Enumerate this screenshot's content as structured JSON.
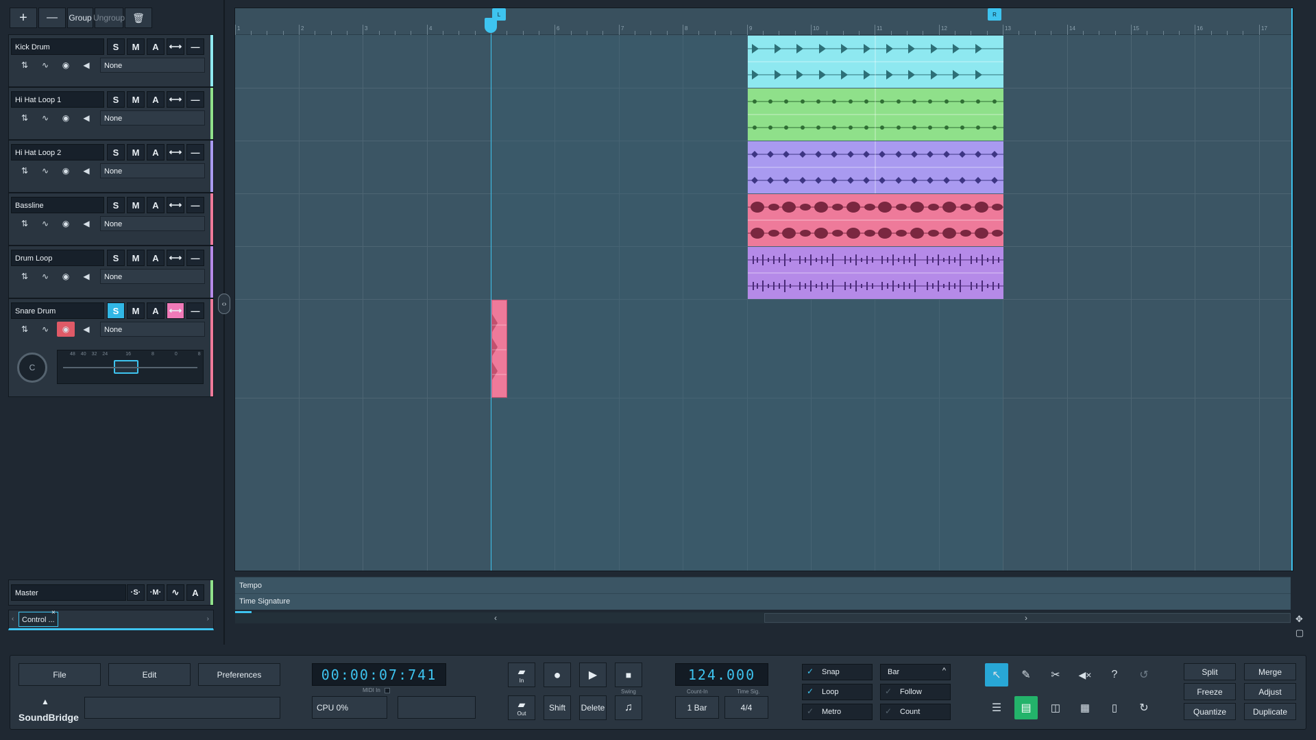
{
  "toolbar": {
    "add": "+",
    "remove": "—",
    "group": "Group",
    "ungroup": "Ungroup",
    "delete": "🗑"
  },
  "tracks": [
    {
      "name": "Kick Drum",
      "color": "#8ee8f0",
      "input": "None"
    },
    {
      "name": "Hi Hat Loop 1",
      "color": "#8fe08a",
      "input": "None"
    },
    {
      "name": "Hi Hat Loop 2",
      "color": "#a99af0",
      "input": "None"
    },
    {
      "name": "Bassline",
      "color": "#ee7a9a",
      "input": "None"
    },
    {
      "name": "Drum Loop",
      "color": "#b58ae8",
      "input": "None"
    },
    {
      "name": "Snare Drum",
      "color": "#ee7a9a",
      "input": "None"
    }
  ],
  "track_buttons": {
    "solo": "S",
    "mute": "M",
    "auto": "A"
  },
  "mixer": {
    "pan_label": "C",
    "scale_labels": [
      "48",
      "40",
      "32",
      "24",
      "16",
      "8",
      "0",
      "8"
    ]
  },
  "master": {
    "name": "Master",
    "solo": "·S·",
    "mute": "·M·",
    "auto": "A"
  },
  "control_tab": "Control ...",
  "ruler": {
    "bars": [
      "1",
      "2",
      "3",
      "4",
      "5",
      "6",
      "7",
      "8",
      "9",
      "10",
      "11",
      "12",
      "13",
      "14",
      "15",
      "16",
      "17"
    ],
    "loop_start": "L",
    "loop_end": "R"
  },
  "automation_lanes": {
    "tempo": "Tempo",
    "time_sig": "Time Signature"
  },
  "bottom": {
    "file": "File",
    "edit": "Edit",
    "preferences": "Preferences",
    "brand": "SoundBridge",
    "time": "00:00:07:741",
    "midi_in": "MIDI In",
    "cpu": "CPU 0%",
    "punch_in": "In",
    "punch_out": "Out",
    "shift": "Shift",
    "delete": "Delete",
    "swing": "Swing",
    "tempo": "124.000",
    "count_in_label": "Count-In",
    "time_sig_label": "Time Sig.",
    "count_in": "1 Bar",
    "time_sig": "4/4",
    "snap": "Snap",
    "loop": "Loop",
    "metro": "Metro",
    "grid": "Bar",
    "follow": "Follow",
    "count": "Count",
    "split": "Split",
    "merge": "Merge",
    "freeze": "Freeze",
    "adjust": "Adjust",
    "quantize": "Quantize",
    "duplicate": "Duplicate"
  }
}
